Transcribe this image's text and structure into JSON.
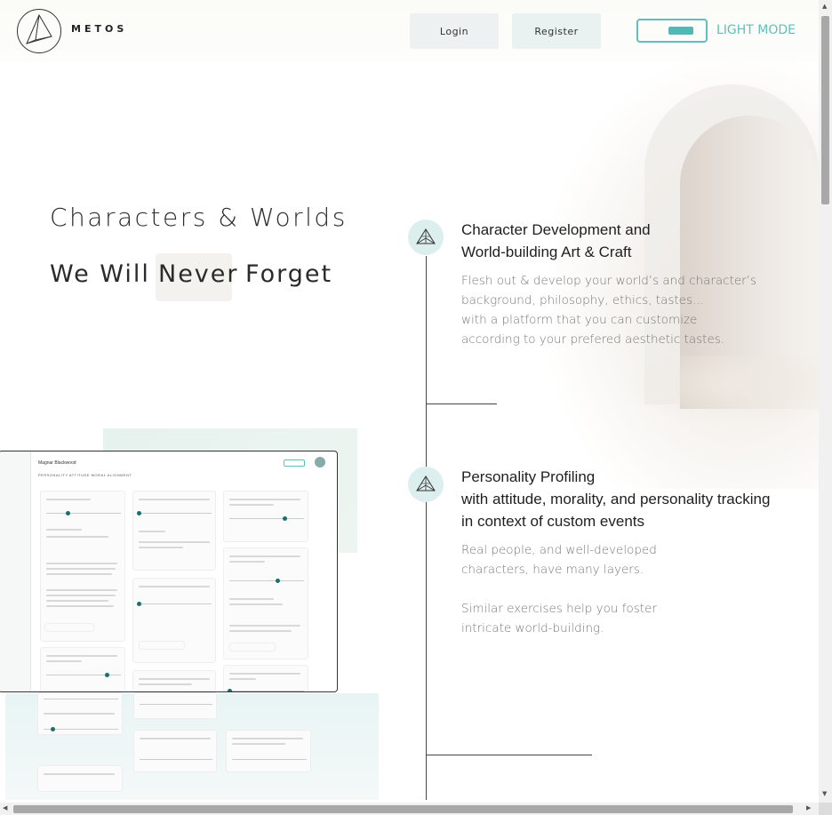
{
  "header": {
    "logo_text": "METOS",
    "login_label": "Login",
    "register_label": "Register",
    "mode_label": "LIGHT MODE"
  },
  "hero": {
    "title": "Characters & Worlds",
    "tagline_words": [
      "We Will",
      "Never",
      "Forget"
    ]
  },
  "features": [
    {
      "title_lines": [
        "Character Development and",
        "World-building Art & Craft"
      ],
      "desc_lines": [
        "Flesh out & develop your world’s and character’s",
        "background, philosophy, ethics, tastes...",
        "with a platform that you can customize",
        "according to your prefered aesthetic tastes."
      ]
    },
    {
      "title_lines": [
        "Personality Profiling",
        "with attitude, morality, and personality tracking",
        "in context of custom events"
      ],
      "desc_lines": [
        "Real people, and well-developed",
        "characters, have many layers."
      ],
      "desc2_lines": [
        "Similar exercises help you foster",
        "intricate world-building."
      ]
    }
  ],
  "preview": {
    "character_name": "Magnar Blackwood",
    "tabs": "PERSONALITY   ATTITUDE   MORAL ALIGNMENT"
  },
  "colors": {
    "accent": "#5fbfbd",
    "icon_bg": "#dceeed",
    "text_dark": "#1f1f1f",
    "text_muted": "#777777"
  },
  "icons": [
    "metos-logo-icon",
    "pyramid-icon",
    "pyramid-icon"
  ]
}
